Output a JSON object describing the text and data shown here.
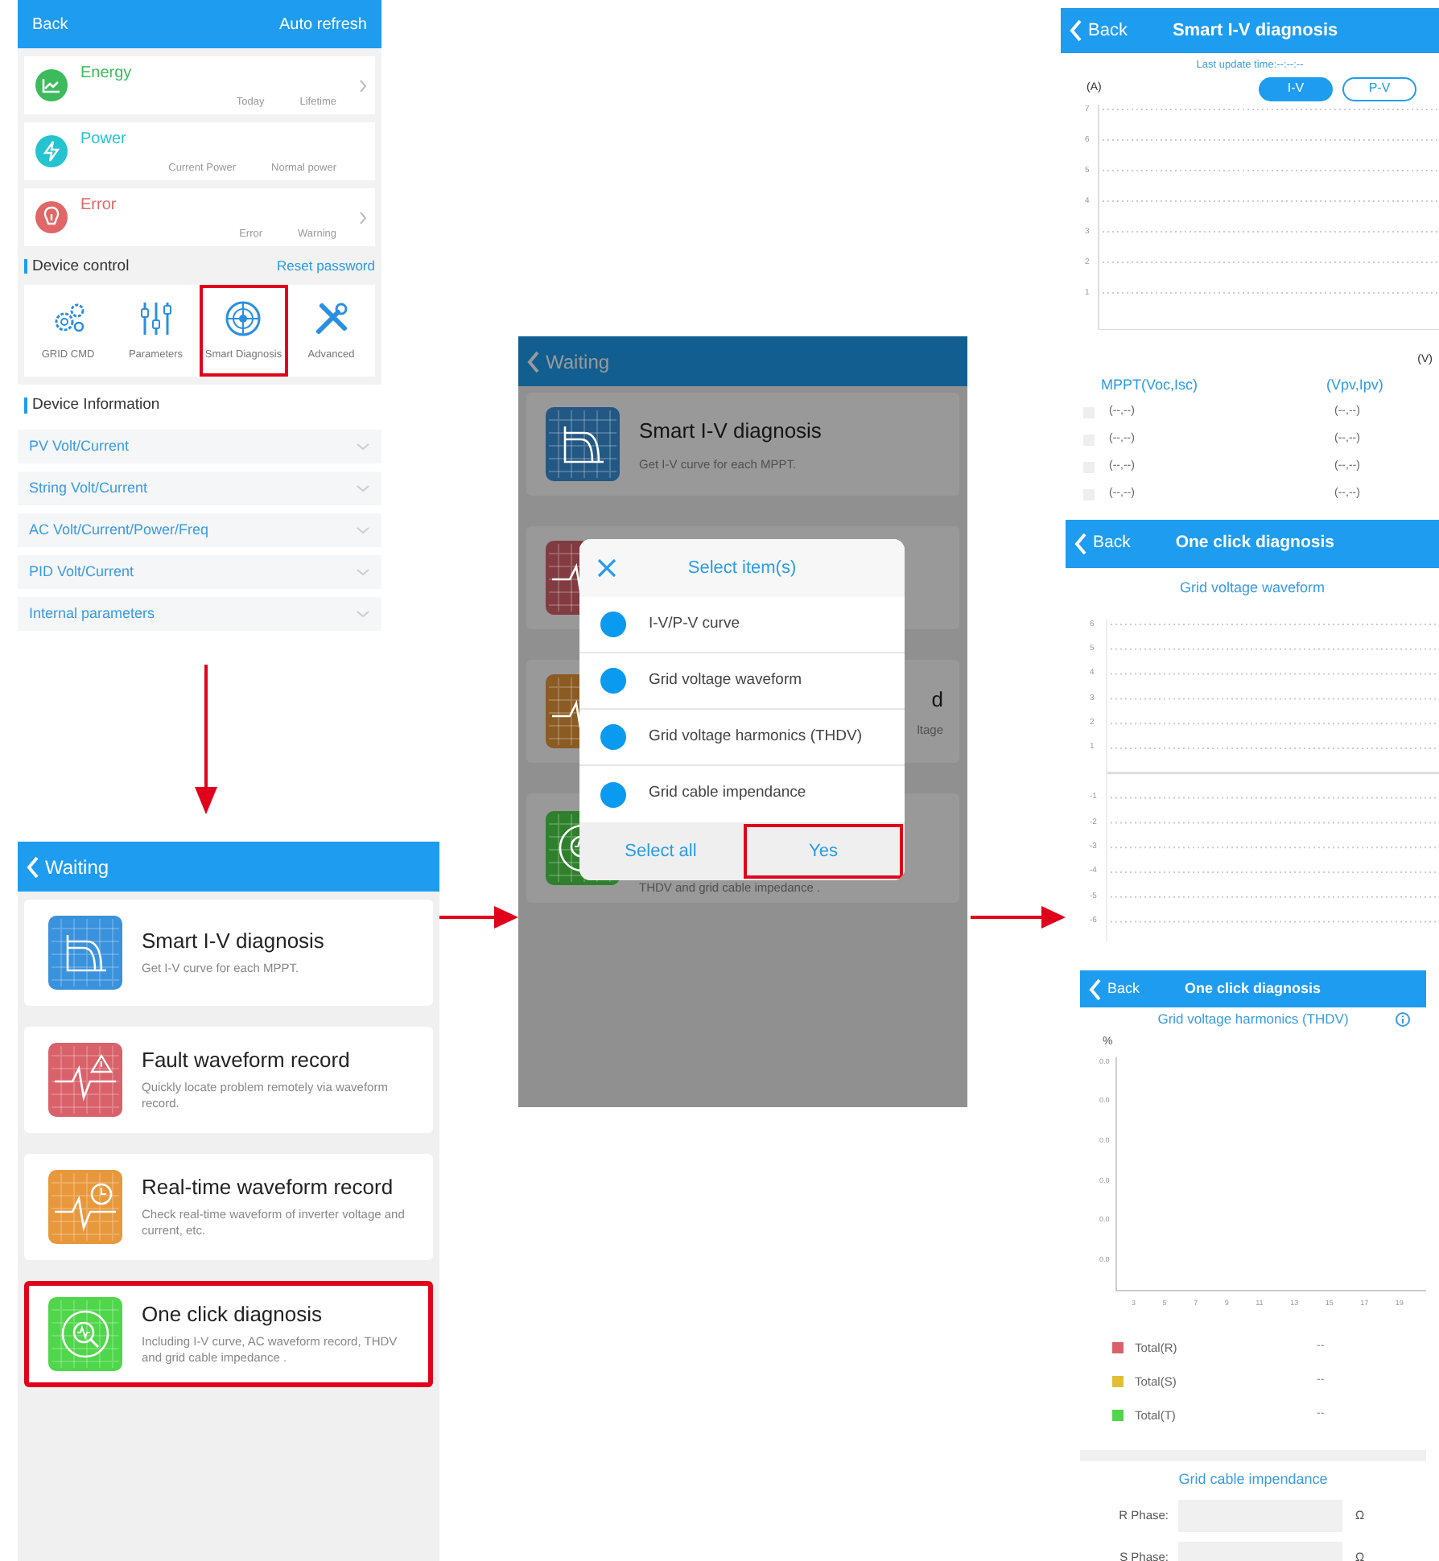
{
  "settings_screen": {
    "header": {
      "back": "Back",
      "action": "Auto refresh"
    },
    "summary_cards": [
      {
        "kind": "chart",
        "title": "Energy",
        "color": "#3dbb5c",
        "labels": [
          "Today",
          "Lifetime"
        ],
        "chevron": true
      },
      {
        "kind": "bolt",
        "title": "Power",
        "color": "#25c3d0",
        "labels": [
          "Current Power",
          "Normal power"
        ],
        "chevron": false
      },
      {
        "kind": "bulb",
        "title": "Error",
        "color": "#e06767",
        "labels": [
          "Error",
          "Warning"
        ],
        "chevron": true
      }
    ],
    "device_control": {
      "title": "Device control",
      "link": "Reset password",
      "items": [
        {
          "kind": "gears",
          "label": "GRID CMD",
          "highlighted": false
        },
        {
          "kind": "sliders",
          "label": "Parameters",
          "highlighted": false
        },
        {
          "kind": "target",
          "label": "Smart Diagnosis",
          "highlighted": true
        },
        {
          "kind": "tools",
          "label": "Advanced",
          "highlighted": false
        }
      ]
    },
    "device_information": {
      "title": "Device Information",
      "rows": [
        {
          "label": "PV Volt/Current"
        },
        {
          "label": "String Volt/Current"
        },
        {
          "label": "AC Volt/Current/Power/Freq"
        },
        {
          "label": "PID Volt/Current"
        },
        {
          "label": "Internal parameters"
        }
      ]
    }
  },
  "diagnosis_list_screen": {
    "header": {
      "back": "Waiting"
    },
    "cards": [
      {
        "kind": "curve",
        "color": "#3a92dc",
        "title": "Smart I-V diagnosis",
        "description": "Get I-V curve for each MPPT.",
        "highlighted": false
      },
      {
        "kind": "fault",
        "color": "#d9626a",
        "title": "Fault waveform record",
        "description": "Quickly locate problem remotely via waveform record.",
        "highlighted": false
      },
      {
        "kind": "realtime",
        "color": "#e8983c",
        "title": "Real-time waveform record",
        "description": "Check real-time waveform of inverter voltage and current, etc.",
        "highlighted": false
      },
      {
        "kind": "oneclick",
        "color": "#4fd64a",
        "title": "One click diagnosis",
        "description": "Including I-V curve, AC waveform record, THDV and grid cable impedance .",
        "highlighted": true
      }
    ]
  },
  "dialog_screen": {
    "header": {
      "back": "Waiting"
    },
    "background_cards": [
      {
        "kind": "curve",
        "color": "#235884",
        "title": "Smart I-V diagnosis",
        "description": "Get I-V curve for each MPPT."
      },
      {
        "kind": "fault",
        "color": "#823b40"
      },
      {
        "kind": "realtime",
        "color": "#8b5b24",
        "title": "d",
        "description": "ltage"
      },
      {
        "kind": "oneclick",
        "color": "#2f802c",
        "description": "THDV and grid cable impedance ."
      }
    ],
    "dialog": {
      "title": "Select item(s)",
      "options": [
        {
          "label": "I-V/P-V curve",
          "selected": true
        },
        {
          "label": "Grid voltage waveform",
          "selected": true
        },
        {
          "label": "Grid voltage harmonics (THDV)",
          "selected": true
        },
        {
          "label": "Grid cable impendance",
          "selected": true
        }
      ],
      "buttons": [
        {
          "label": "Select all",
          "highlighted": false
        },
        {
          "label": "Yes",
          "highlighted": true
        }
      ]
    }
  },
  "iv_screen": {
    "header": {
      "back": "Back",
      "title": "Smart I-V diagnosis"
    },
    "last_update": "Last update time:--:--:--",
    "y_unit": "(A)",
    "tabs": [
      {
        "label": "I-V",
        "selected": true
      },
      {
        "label": "P-V",
        "selected": false
      }
    ],
    "y_labels": [
      "7",
      "6",
      "5",
      "4",
      "3",
      "2",
      "1"
    ],
    "x_unit": "(V)",
    "table": {
      "columns": [
        "MPPT(Voc,Isc)",
        "(Vpv,Ipv)"
      ],
      "rows": [
        {
          "checked": false,
          "cells": [
            "(--,--)",
            "(--,--)"
          ]
        },
        {
          "checked": false,
          "cells": [
            "(--,--)",
            "(--,--)"
          ]
        },
        {
          "checked": false,
          "cells": [
            "(--,--)",
            "(--,--)"
          ]
        },
        {
          "checked": false,
          "cells": [
            "(--,--)",
            "(--,--)"
          ]
        }
      ]
    }
  },
  "waveform_screen": {
    "header": {
      "back": "Back",
      "title": "One click diagnosis"
    },
    "chart_title": "Grid voltage waveform",
    "y_labels_positive": [
      "6",
      "5",
      "4",
      "3",
      "2",
      "1"
    ],
    "y_labels_negative": [
      "-1",
      "-2",
      "-3",
      "-4",
      "-5",
      "-6"
    ]
  },
  "harmonics_screen": {
    "header": {
      "back": "Back",
      "title": "One click diagnosis"
    },
    "chart_title": "Grid voltage harmonics (THDV)",
    "y_unit": "%",
    "y_labels": [
      "0.0",
      "0.0",
      "0.0",
      "0.0",
      "0.0",
      "0.0"
    ],
    "x_labels": [
      "3",
      "5",
      "7",
      "9",
      "11",
      "13",
      "15",
      "17",
      "19"
    ],
    "legend": [
      {
        "label": "Total(R)",
        "color": "#d9626a",
        "value": "--"
      },
      {
        "label": "Total(S)",
        "color": "#e0c030",
        "value": "--"
      },
      {
        "label": "Total(T)",
        "color": "#4fd64a",
        "value": "--"
      }
    ],
    "impedance_title": "Grid cable impendance",
    "phases": [
      {
        "label": "R Phase:",
        "unit": "Ω"
      },
      {
        "label": "S Phase:",
        "unit": "Ω"
      }
    ]
  }
}
